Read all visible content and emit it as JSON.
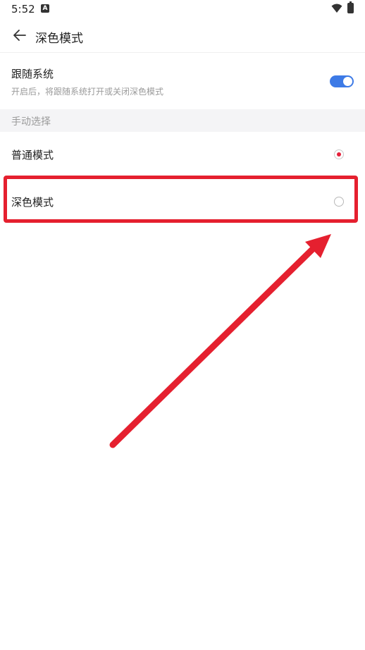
{
  "status_bar": {
    "time": "5:52",
    "app_icon_letter": "A"
  },
  "header": {
    "title": "深色模式",
    "back_icon": "arrow-left-icon"
  },
  "follow_system": {
    "title": "跟随系统",
    "description": "开启后，将跟随系统打开或关闭深色模式",
    "enabled": true
  },
  "manual": {
    "section_label": "手动选择",
    "options": [
      {
        "label": "普通模式",
        "selected": true
      },
      {
        "label": "深色模式",
        "selected": false
      }
    ]
  },
  "colors": {
    "toggle_on": "#3d7ae6",
    "radio_selected": "#e5203a",
    "annotation": "#e5202f",
    "section_bg": "#f4f4f6"
  }
}
